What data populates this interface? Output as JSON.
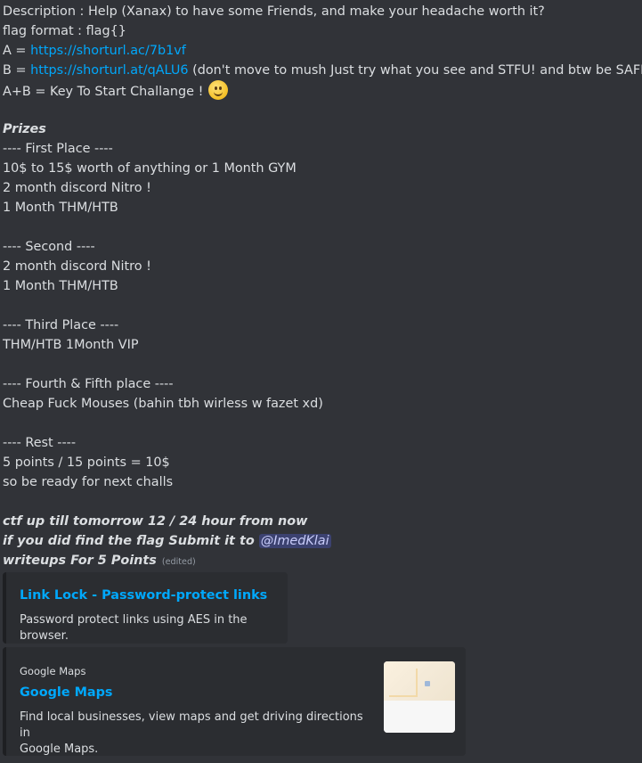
{
  "message": {
    "description": "Description : Help (Xanax) to have some Friends, and make your headache worth it?",
    "flag_format": "flag format : flag{}",
    "a_prefix": "A = ",
    "a_link": "https://shorturl.ac/7b1vf",
    "b_prefix": "B = ",
    "b_link": "https://shorturl.at/qALU6",
    "b_suffix": " (don't move to mush Just try what you see and STFU! and btw be SAFE :D)",
    "ab_key": "A+B = Key To Start Challange ! ",
    "prizes_heading": "Prizes",
    "first_header": "---- First Place ----",
    "first_1": "10$ to 15$ worth of anything or 1 Month GYM",
    "first_2": "2 month discord Nitro !",
    "first_3": "1 Month THM/HTB",
    "second_header": "---- Second ----",
    "second_1": "2 month discord Nitro !",
    "second_2": "1 Month THM/HTB",
    "third_header": "---- Third Place  ----",
    "third_1": "THM/HTB 1Month VIP",
    "fourth_header": "---- Fourth & Fifth place ----",
    "fourth_1": "Cheap Fuck Mouses (bahin tbh wirless w fazet xd)",
    "rest_header": "---- Rest ----",
    "rest_1": "5 points / 15 points = 10$",
    "rest_2": "so be ready for next challs",
    "ctf_line": " ctf up till tomorrow 12  /  24 hour from now",
    "submit_prefix": " if you did find the flag Submit it to ",
    "mention": "@ImedKlai",
    "writeups": "  writeups For 5 Points",
    "edited": "(edited)",
    "emoji": "slightly-smiling-face"
  },
  "embeds": [
    {
      "title": "Link Lock - Password-protect links",
      "description": "Password protect links using AES in the browser."
    },
    {
      "provider": "Google Maps",
      "title": "Google Maps",
      "description_line1": "Find local businesses, view maps and get driving directions in",
      "description_line2": "Google Maps."
    }
  ],
  "colors": {
    "background": "#313338",
    "text": "#dbdee1",
    "link": "#00a8fc",
    "embed_bg": "#2b2d31",
    "mention_bg": "#3c4270"
  }
}
